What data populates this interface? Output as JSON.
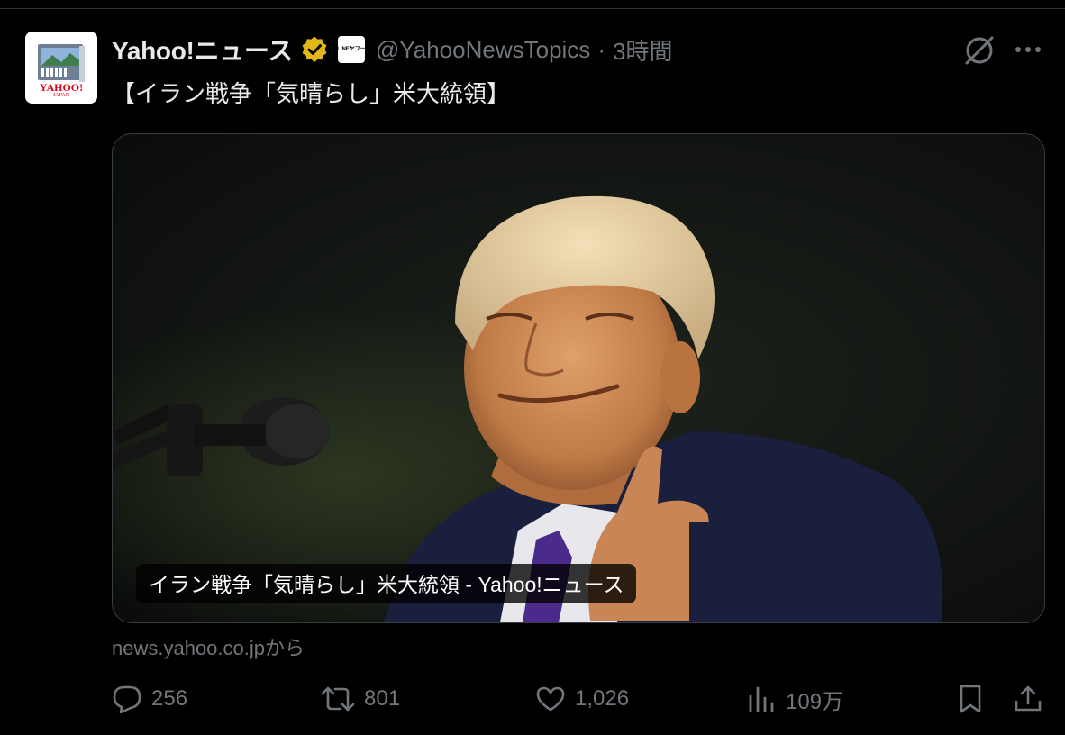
{
  "post": {
    "avatar_icon": "yahoo-news-logo",
    "avatar_text": "YAHOO!",
    "avatar_subtext": "JAPAN",
    "display_name": "Yahoo!ニュース",
    "verified_icon": "gold-verified-badge-icon",
    "affiliate_label": "LINEヤフー",
    "handle": "@YahooNewsTopics",
    "separator": "·",
    "time": "3時間",
    "text": "【イラン戦争「気晴らし」米大統領】"
  },
  "card": {
    "image_alt": "photo",
    "caption": "イラン戦争「気晴らし」米大統領 - Yahoo!ニュース",
    "source": "news.yahoo.co.jpから"
  },
  "actions": {
    "replies": "256",
    "reposts": "801",
    "likes": "1,026",
    "views": "109万"
  },
  "colors": {
    "background": "#000000",
    "text": "#e7e9ea",
    "muted": "#71767b",
    "verified_gold": "#e2b719"
  }
}
